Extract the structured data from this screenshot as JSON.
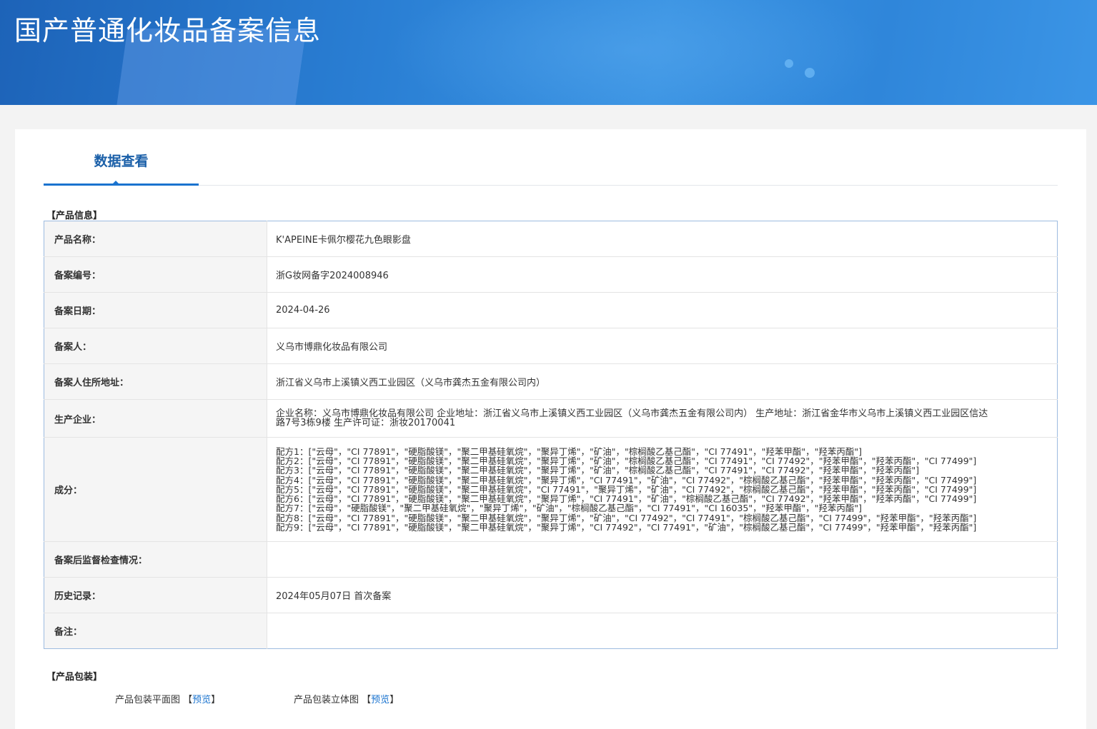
{
  "header": {
    "title": "国产普通化妆品备案信息"
  },
  "tabs": [
    {
      "label": "数据查看"
    }
  ],
  "product_info": {
    "section_label": "【产品信息】",
    "rows": [
      {
        "label": "产品名称：",
        "value": "K'APEINE卡佩尔樱花九色眼影盘"
      },
      {
        "label": "备案编号：",
        "value": "浙G妆网备字2024008946"
      },
      {
        "label": "备案日期：",
        "value": "2024-04-26"
      },
      {
        "label": "备案人：",
        "value": "义乌市博鼎化妆品有限公司"
      },
      {
        "label": "备案人住所地址：",
        "value": "浙江省义乌市上溪镇义西工业园区（义乌市龚杰五金有限公司内）"
      },
      {
        "label": "生产企业：",
        "value_lines": [
          "企业名称：义乌市博鼎化妆品有限公司 企业地址：浙江省义乌市上溪镇义西工业园区（义乌市龚杰五金有限公司内） 生产地址：浙江省金华市义乌市上溪镇义西工业园区信达",
          "路7号3栋9楼 生产许可证：浙妆20170041"
        ]
      },
      {
        "label": "成分：",
        "formulas": [
          "配方1：[\"云母\"，\"CI 77891\"，\"硬脂酸镁\"，\"聚二甲基硅氧烷\"，\"聚异丁烯\"，\"矿油\"，\"棕榈酸乙基己酯\"，\"CI 77491\"，\"羟苯甲酯\"，\"羟苯丙酯\"]",
          "配方2：[\"云母\"，\"CI 77891\"，\"硬脂酸镁\"，\"聚二甲基硅氧烷\"，\"聚异丁烯\"，\"矿油\"，\"棕榈酸乙基己酯\"，\"CI 77491\"，\"CI 77492\"，\"羟苯甲酯\"，\"羟苯丙酯\"，\"CI 77499\"]",
          "配方3：[\"云母\"，\"CI 77891\"，\"硬脂酸镁\"，\"聚二甲基硅氧烷\"，\"聚异丁烯\"，\"矿油\"，\"棕榈酸乙基己酯\"，\"CI 77491\"，\"CI 77492\"，\"羟苯甲酯\"，\"羟苯丙酯\"]",
          "配方4：[\"云母\"，\"CI 77891\"，\"硬脂酸镁\"，\"聚二甲基硅氧烷\"，\"聚异丁烯\"，\"CI 77491\"，\"矿油\"，\"CI 77492\"，\"棕榈酸乙基己酯\"，\"羟苯甲酯\"，\"羟苯丙酯\"，\"CI 77499\"]",
          "配方5：[\"云母\"，\"CI 77891\"，\"硬脂酸镁\"，\"聚二甲基硅氧烷\"，\"CI 77491\"，\"聚异丁烯\"，\"矿油\"，\"CI 77492\"，\"棕榈酸乙基己酯\"，\"羟苯甲酯\"，\"羟苯丙酯\"，\"CI 77499\"]",
          "配方6：[\"云母\"，\"CI 77891\"，\"硬脂酸镁\"，\"聚二甲基硅氧烷\"，\"聚异丁烯\"，\"CI 77491\"，\"矿油\"，\"棕榈酸乙基己酯\"，\"CI 77492\"，\"羟苯甲酯\"，\"羟苯丙酯\"，\"CI 77499\"]",
          "配方7：[\"云母\"，\"硬脂酸镁\"，\"聚二甲基硅氧烷\"，\"聚异丁烯\"，\"矿油\"，\"棕榈酸乙基己酯\"，\"CI 77491\"，\"CI 16035\"，\"羟苯甲酯\"，\"羟苯丙酯\"]",
          "配方8：[\"云母\"，\"CI 77891\"，\"硬脂酸镁\"，\"聚二甲基硅氧烷\"，\"聚异丁烯\"，\"矿油\"，\"CI 77492\"，\"CI 77491\"，\"棕榈酸乙基己酯\"，\"CI 77499\"，\"羟苯甲酯\"，\"羟苯丙酯\"]",
          "配方9：[\"云母\"，\"CI 77891\"，\"硬脂酸镁\"，\"聚二甲基硅氧烷\"，\"聚异丁烯\"，\"CI 77492\"，\"CI 77491\"，\"矿油\"，\"棕榈酸乙基己酯\"，\"CI 77499\"，\"羟苯甲酯\"，\"羟苯丙酯\"]"
        ]
      },
      {
        "label": "备案后监督检查情况：",
        "value": ""
      },
      {
        "label": "历史记录：",
        "value": "2024年05月07日 首次备案"
      },
      {
        "label": "备注：",
        "value": ""
      }
    ]
  },
  "packaging": {
    "section_label": "【产品包装】",
    "flat_label": "产品包装平面图",
    "stereo_label": "产品包装立体图",
    "preview_label": "预览",
    "bracket_open": "【",
    "bracket_close": "】"
  },
  "colors": {
    "banner": "#2a7fd4",
    "tab_active": "#1a73cf",
    "table_border": "#9dbbe0",
    "label_bg": "#f5f5f5",
    "link": "#1a73cf"
  }
}
